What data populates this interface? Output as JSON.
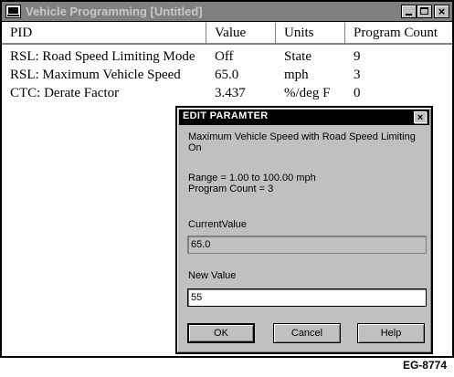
{
  "window": {
    "title": "Vehicle Programming [Untitled]",
    "icon": "computer-icon",
    "controls": {
      "minimize": "minimize-icon",
      "maximize": "maximize-icon",
      "close": "×"
    }
  },
  "table": {
    "headers": [
      "PID",
      "Value",
      "Units",
      "Program Count"
    ],
    "rows": [
      {
        "pid": "RSL: Road Speed Limiting Mode",
        "value": "Off",
        "units": "State",
        "count": "9"
      },
      {
        "pid": "RSL: Maximum Vehicle Speed",
        "value": "65.0",
        "units": "mph",
        "count": "3"
      },
      {
        "pid": "CTC: Derate Factor",
        "value": "3.437",
        "units": "%/deg F",
        "count": "0"
      }
    ]
  },
  "dialog": {
    "title": "EDIT PARAMTER",
    "close": "×",
    "description_line1": "Maximum Vehicle Speed with Road Speed Limiting",
    "description_line2": "On",
    "range": "Range = 1.00  to 100.00  mph",
    "program_count": "Program Count = 3",
    "current_value_label": "CurrentValue",
    "current_value": "65.0",
    "new_value_label": "New Value",
    "new_value": "55",
    "buttons": {
      "ok": "OK",
      "cancel": "Cancel",
      "help": "Help"
    }
  },
  "figure_id": "EG-8774"
}
